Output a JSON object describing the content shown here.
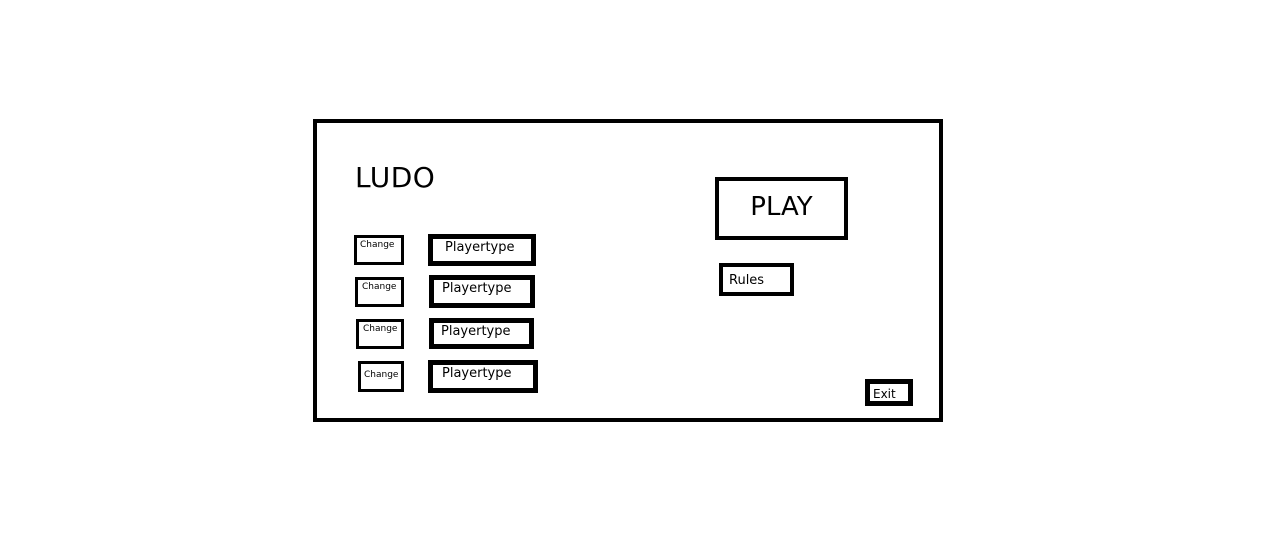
{
  "app": {
    "title": "LUDO"
  },
  "players": [
    {
      "change_label": "Change",
      "type_label": "Playertype"
    },
    {
      "change_label": "Change",
      "type_label": "Playertype"
    },
    {
      "change_label": "Change",
      "type_label": "Playertype"
    },
    {
      "change_label": "Change",
      "type_label": "Playertype"
    }
  ],
  "actions": {
    "play_label": "PLAY",
    "rules_label": "Rules",
    "exit_label": "Exit"
  },
  "colors": {
    "background": "#ffffff",
    "border": "#000000"
  }
}
